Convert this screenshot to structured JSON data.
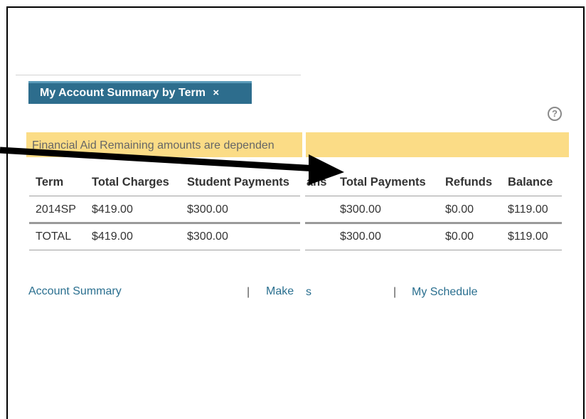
{
  "tab": {
    "title": "My Account Summary by Term",
    "close_glyph": "×"
  },
  "help_glyph": "?",
  "notice": {
    "text": "Financial Aid Remaining amounts are dependen"
  },
  "table": {
    "headers": {
      "term": "Term",
      "total_charges": "Total Charges",
      "student_payments": "Student Payments",
      "partial": "ans",
      "total_payments": "Total Payments",
      "refunds": "Refunds",
      "balance": "Balance"
    },
    "rows": [
      {
        "term": "2014SP",
        "total_charges": "$419.00",
        "student_payments": "$300.00",
        "total_payments": "$300.00",
        "refunds": "$0.00",
        "balance": "$119.00"
      },
      {
        "term": "TOTAL",
        "total_charges": "$419.00",
        "student_payments": "$300.00",
        "total_payments": "$300.00",
        "refunds": "$0.00",
        "balance": "$119.00"
      }
    ]
  },
  "links": {
    "account_summary": "Account Summary",
    "make_payment": "Make",
    "make_payment_tail": "s",
    "my_schedule": "My Schedule",
    "separator": "|"
  },
  "colors": {
    "tab_bg": "#2d6d8d",
    "notice_bg": "#fbdc86",
    "link": "#2a6f8f"
  }
}
